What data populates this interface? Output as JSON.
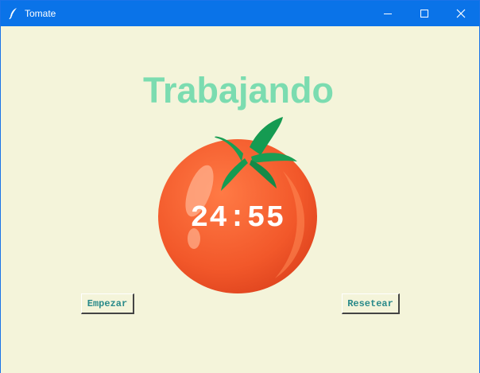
{
  "window": {
    "title": "Tomate",
    "app_icon": "feather-icon",
    "controls": [
      "minimize-icon",
      "maximize-icon",
      "close-icon"
    ]
  },
  "main": {
    "heading": "Trabajando",
    "timer": "24:55",
    "image": "tomato-icon"
  },
  "buttons": {
    "start_label": "Empezar",
    "reset_label": "Resetear"
  },
  "colors": {
    "background": "#f4f4da",
    "heading": "#7bdcb0",
    "titlebar": "#0a73e8",
    "tomato": "#f05a28",
    "leaf": "#1a9e54",
    "button_text": "#2a8a8a"
  }
}
